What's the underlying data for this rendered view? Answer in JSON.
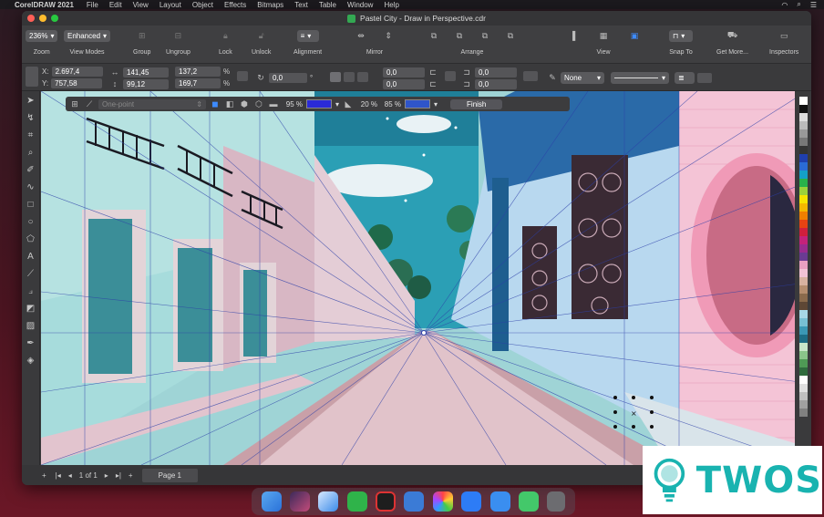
{
  "menubar": {
    "app_name": "CorelDRAW 2021",
    "items": [
      "File",
      "Edit",
      "View",
      "Layout",
      "Object",
      "Effects",
      "Bitmaps",
      "Text",
      "Table",
      "Window",
      "Help"
    ]
  },
  "window": {
    "title": "Pastel City - Draw in Perspective.cdr"
  },
  "toolbar": {
    "zoom_value": "236%",
    "zoom_label": "Zoom",
    "view_mode_value": "Enhanced",
    "view_modes_label": "View Modes",
    "group_label": "Group",
    "ungroup_label": "Ungroup",
    "lock_label": "Lock",
    "unlock_label": "Unlock",
    "alignment_label": "Alignment",
    "mirror_label": "Mirror",
    "arrange_label": "Arrange",
    "view_label": "View",
    "snap_to_label": "Snap To",
    "get_more_label": "Get More...",
    "inspectors_label": "Inspectors"
  },
  "propbar": {
    "x_label": "X:",
    "x_value": "2.697,4",
    "y_label": "Y:",
    "y_value": "757,58",
    "w_value": "141,45",
    "h_value": "99,12",
    "sw_value": "137,2",
    "sh_value": "169,7",
    "pct_symbol": "%",
    "rotation_value": "0,0",
    "degree_symbol": "°",
    "pos_a": "0,0",
    "pos_b": "0,0",
    "pos_c": "0,0",
    "pos_d": "0,0",
    "outline_value": "None"
  },
  "perspective_bar": {
    "mode_placeholder": "One-point",
    "opacity1": "95 %",
    "opacity2": "20 %",
    "opacity3": "85 %",
    "finish_label": "Finish",
    "swatch1_color": "#2a2ad8",
    "swatch2_color": "#2f55c9"
  },
  "pagebar": {
    "page_counter": "1 of 1",
    "page_tab": "Page 1"
  },
  "palette": {
    "colors": [
      "#ffffff",
      "#111111",
      "#dddddd",
      "#bbbbbb",
      "#999999",
      "#777777",
      "#333333",
      "#1f3fae",
      "#2a6bd6",
      "#14a0c8",
      "#28b24a",
      "#9bd23a",
      "#f5e400",
      "#f3b800",
      "#f07f00",
      "#e64313",
      "#d01f3c",
      "#c4227a",
      "#9a2c8f",
      "#6a3b93",
      "#e9a0c2",
      "#f2c3d6",
      "#d8b2a0",
      "#b58d6e",
      "#8a6a4c",
      "#5e4735",
      "#a7d7e6",
      "#78c0d4",
      "#3b98b5",
      "#1d6d85",
      "#c9e7c9",
      "#8ac58a",
      "#4f9a55",
      "#2f6b3d",
      "#ffffff",
      "#e0e0e0",
      "#c0c0c0",
      "#a0a0a0",
      "#808080"
    ]
  },
  "watermark": {
    "text": "TWOS"
  }
}
